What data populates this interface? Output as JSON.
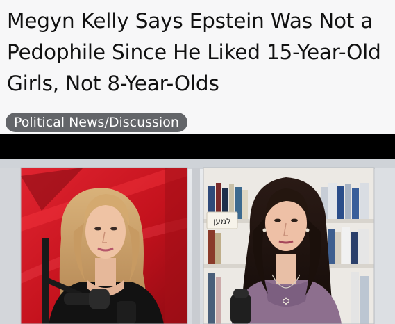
{
  "post": {
    "title": "Megyn Kelly Says Epstein Was Not a Pedophile Since He Liked 15-Year-Old Girls, Not 8-Year-Olds",
    "flair": "Political News/Discussion"
  },
  "media": {
    "right_sign_text": "למען"
  },
  "colors": {
    "page_background": "#f7f7f8",
    "flair_background": "#636569",
    "flair_text": "#ffffff",
    "title_text": "#111111",
    "left_panel_red": "#c4121d",
    "letterbox": "#000000"
  }
}
